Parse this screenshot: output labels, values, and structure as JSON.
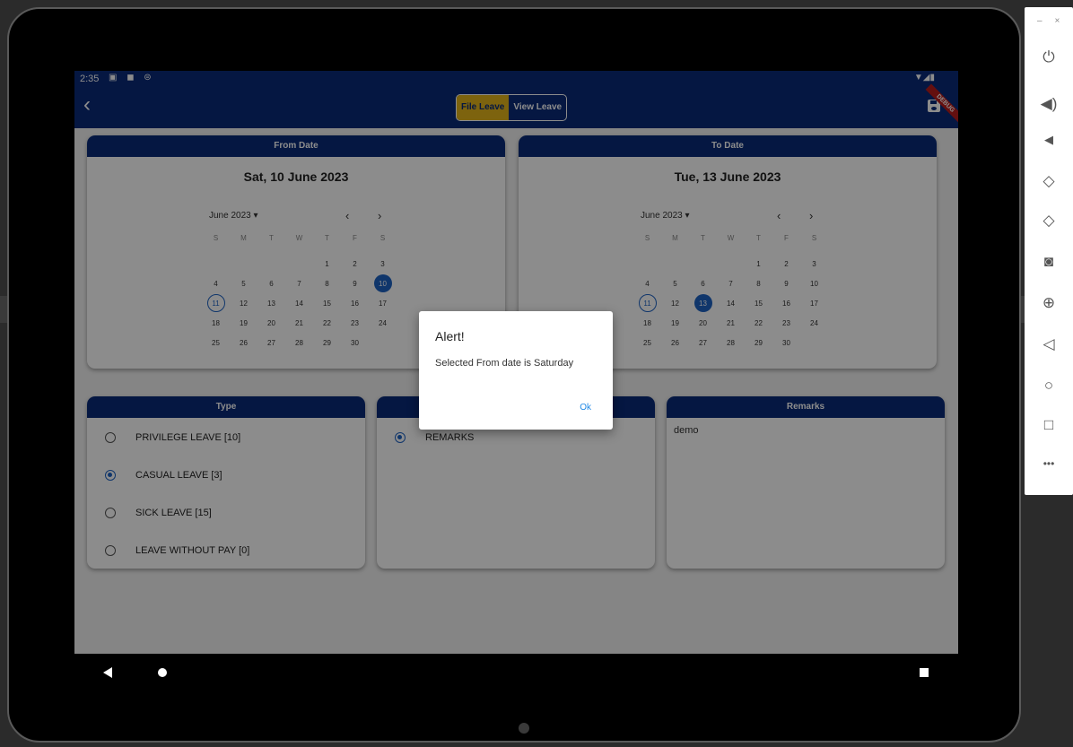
{
  "status_bar": {
    "time": "2:35",
    "left_icons": "▣ ◼ ⊜",
    "right_icons": "▼◢▮"
  },
  "app_bar": {
    "tabs": [
      {
        "label": "File Leave"
      },
      {
        "label": "View Leave"
      }
    ],
    "debug_banner": "DEBUG"
  },
  "from_date": {
    "header": "From Date",
    "selected_display": "Sat, 10 June 2023",
    "month_label": "June 2023 ▾",
    "weekdays": [
      "S",
      "M",
      "T",
      "W",
      "T",
      "F",
      "S"
    ],
    "selected_day": 10,
    "today_day": 11
  },
  "to_date": {
    "header": "To Date",
    "selected_display": "Tue, 13 June 2023",
    "month_label": "June 2023 ▾",
    "weekdays": [
      "S",
      "M",
      "T",
      "W",
      "T",
      "F",
      "S"
    ],
    "selected_day": 13,
    "today_day": 11
  },
  "calendar_days": [
    "",
    "",
    "",
    "",
    "1",
    "2",
    "3",
    "4",
    "5",
    "6",
    "7",
    "8",
    "9",
    "10",
    "11",
    "12",
    "13",
    "14",
    "15",
    "16",
    "17",
    "18",
    "19",
    "20",
    "21",
    "22",
    "23",
    "24",
    "25",
    "26",
    "27",
    "28",
    "29",
    "30"
  ],
  "type_card": {
    "header": "Type",
    "options": [
      {
        "label": "PRIVILEGE LEAVE [10]",
        "selected": false
      },
      {
        "label": "CASUAL LEAVE [3]",
        "selected": true
      },
      {
        "label": "SICK LEAVE [15]",
        "selected": false
      },
      {
        "label": "LEAVE WITHOUT PAY [0]",
        "selected": false
      }
    ]
  },
  "middle_card": {
    "options": [
      {
        "label": "REMARKS",
        "selected": true
      }
    ]
  },
  "remarks_card": {
    "header": "Remarks",
    "value": "demo"
  },
  "dialog": {
    "title": "Alert!",
    "message": "Selected From date is Saturday",
    "ok_label": "Ok"
  },
  "colors": {
    "primary": "#0a2a78",
    "accent": "#e3b51a",
    "selection": "#1e63c4"
  }
}
